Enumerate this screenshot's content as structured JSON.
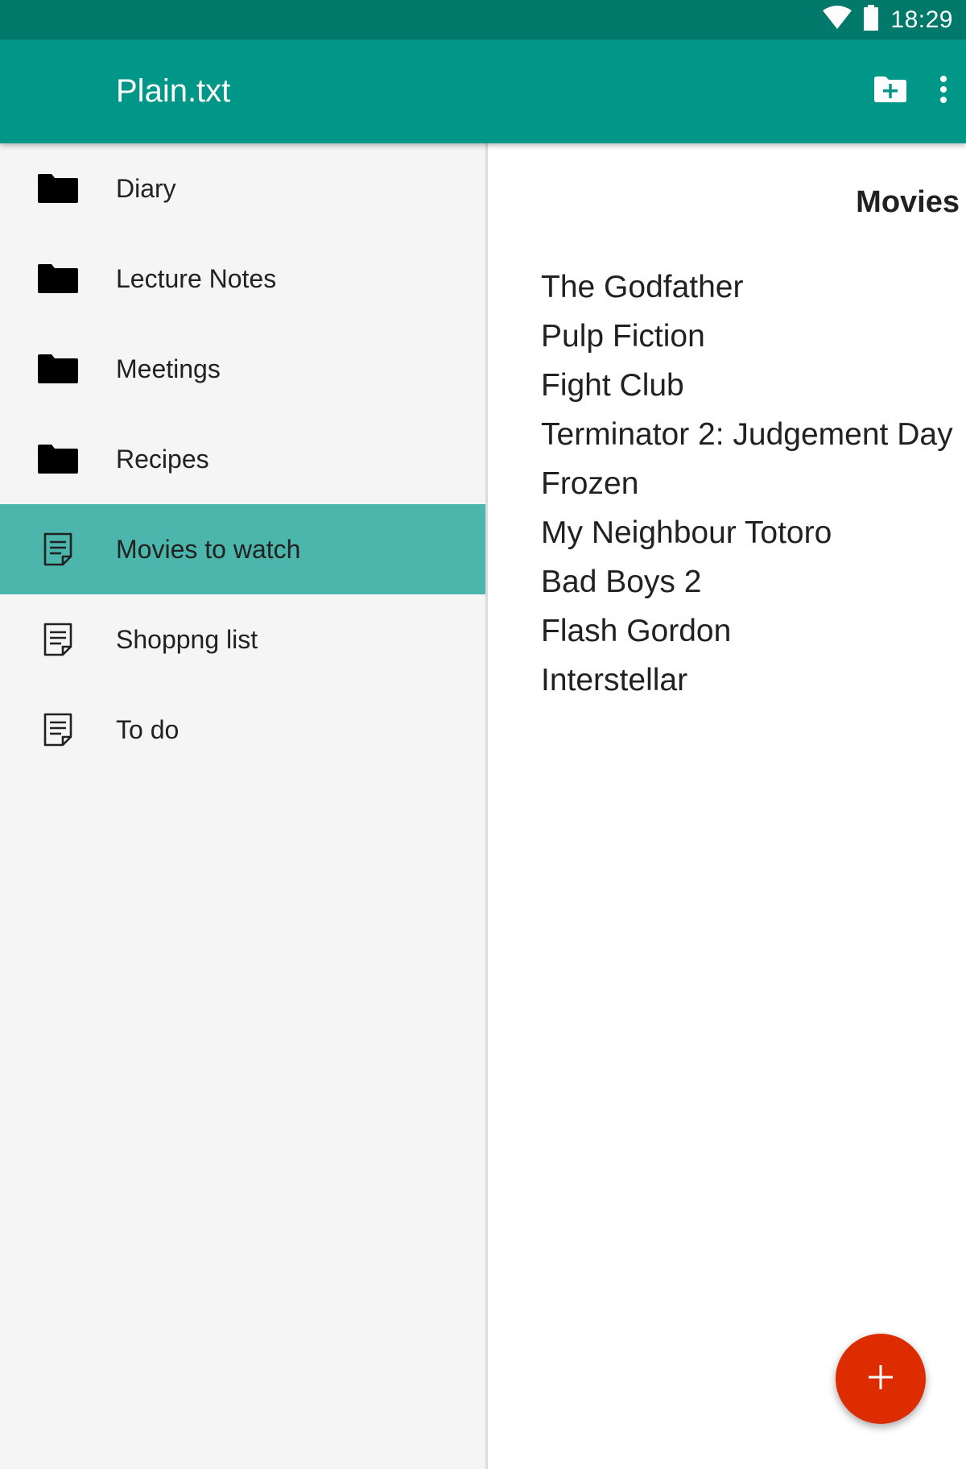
{
  "status_bar": {
    "time": "18:29",
    "icons": [
      "wifi-icon",
      "battery-icon"
    ]
  },
  "app_bar": {
    "title": "Plain.txt",
    "actions": [
      "new-folder-icon",
      "more-vert-icon"
    ],
    "color": "#009688"
  },
  "sidebar": {
    "items": [
      {
        "label": "Diary",
        "icon": "folder-icon",
        "selected": false
      },
      {
        "label": "Lecture Notes",
        "icon": "folder-icon",
        "selected": false
      },
      {
        "label": "Meetings",
        "icon": "folder-icon",
        "selected": false
      },
      {
        "label": "Recipes",
        "icon": "folder-icon",
        "selected": false
      },
      {
        "label": "Movies to watch",
        "icon": "note-icon",
        "selected": true
      },
      {
        "label": "Shoppng list",
        "icon": "note-icon",
        "selected": false
      },
      {
        "label": "To do",
        "icon": "note-icon",
        "selected": false
      }
    ],
    "selected_color": "#4db6ac"
  },
  "note": {
    "title": "Movies",
    "lines": [
      "The Godfather",
      "Pulp Fiction",
      "Fight Club",
      "Terminator 2: Judgement Day",
      "Frozen",
      "My Neighbour Totoro",
      "Bad Boys 2",
      "Flash Gordon",
      "Interstellar"
    ]
  },
  "fab": {
    "icon": "add-icon",
    "color": "#dd2c00"
  }
}
